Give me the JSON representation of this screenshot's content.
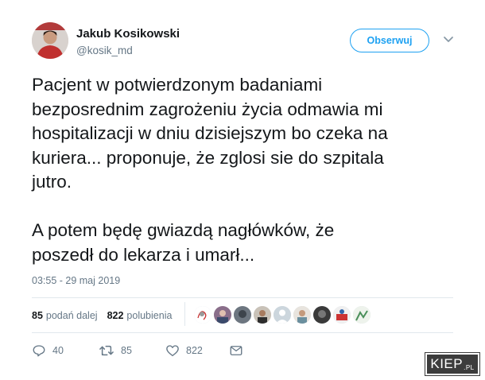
{
  "author": {
    "name": "Jakub Kosikowski",
    "handle": "@kosik_md"
  },
  "follow_label": "Obserwuj",
  "tweet": {
    "text": "Pacjent w potwierdzonym badaniami\nbezposrednim zagrożeniu życia odmawia mi\nhospitalizacji w dniu dzisiejszym bo czeka na\nkuriera... proponuje, że zglosi sie do szpitala\njutro.\n\nA potem będę gwiazdą nagłówków, że\nposzedł do lekarza i umarł...",
    "timestamp": "03:55 - 29 maj 2019"
  },
  "stats": {
    "retweets_count": "85",
    "retweets_label": "podań dalej",
    "likes_count": "822",
    "likes_label": "polubienia"
  },
  "likers_icons": [
    "avatar-1",
    "avatar-2",
    "avatar-3",
    "avatar-4",
    "avatar-5",
    "avatar-6",
    "avatar-7",
    "avatar-8",
    "avatar-9"
  ],
  "actions": {
    "replies": "40",
    "retweets": "85",
    "likes": "822"
  },
  "watermark": {
    "main": "KIEP",
    "suffix": ".PL"
  },
  "colors": {
    "accent": "#1da1f2",
    "muted": "#657786",
    "text": "#14171a",
    "divider": "#e1e8ed"
  }
}
